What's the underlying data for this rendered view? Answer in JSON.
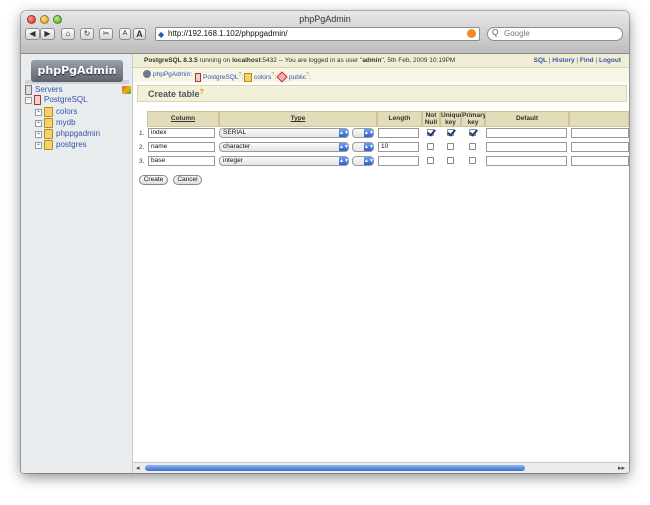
{
  "browser": {
    "window_title": "phpPgAdmin",
    "url": "http://192.168.1.102/phppgadmin/",
    "search_placeholder": "Google",
    "search_prefix": "Q",
    "back": "◀",
    "forward": "▶",
    "home": "⌂",
    "reload": "↻",
    "bookmark": "✂",
    "text_smaller": "A",
    "text_larger": "A"
  },
  "sidebar": {
    "logo": "phpPgAdmin",
    "servers_label": "Servers",
    "server_name": "PostgreSQL",
    "databases": [
      {
        "name": "colors"
      },
      {
        "name": "mydb"
      },
      {
        "name": "phppgadmin"
      },
      {
        "name": "postgres"
      }
    ],
    "expand_glyph": "+"
  },
  "topbar": {
    "product": "PostgreSQL 8.3.5",
    "running_on": "running on",
    "host": "localhost",
    "port_text": ":5432 -- You are logged in as user \"",
    "user": "admin",
    "date_text": "\", 5th Feb, 2009 10:19PM",
    "links": [
      "SQL",
      "History",
      "Find",
      "Logout"
    ],
    "link_sep": "|"
  },
  "breadcrumb": {
    "items": [
      "phpPgAdmin",
      "PostgreSQL",
      "colors",
      "public"
    ],
    "sep": ":",
    "help_mark": "?"
  },
  "page": {
    "title": "Create table",
    "title_help": "?"
  },
  "table": {
    "headers": {
      "column": "Column",
      "type": "Type",
      "length": "Length",
      "not_null_1": "Not",
      "not_null_2": "Null",
      "unique_1": "Unique",
      "unique_2": "key",
      "primary_1": "Primary",
      "primary_2": "key",
      "default": "Default"
    },
    "rows": [
      {
        "num": "1.",
        "column": "index",
        "type": "SERIAL",
        "length": "",
        "not_null": true,
        "unique": true,
        "primary": true,
        "default": ""
      },
      {
        "num": "2.",
        "column": "name",
        "type": "character",
        "length": "10",
        "not_null": false,
        "unique": false,
        "primary": false,
        "default": ""
      },
      {
        "num": "3.",
        "column": "base",
        "type": "integer",
        "length": "",
        "not_null": false,
        "unique": false,
        "primary": false,
        "default": ""
      }
    ],
    "select_arrows": "▲▼"
  },
  "actions": {
    "create": "Create",
    "cancel": "Cancel"
  },
  "scrollbar": {
    "left": "◂",
    "right": "▸▸"
  }
}
